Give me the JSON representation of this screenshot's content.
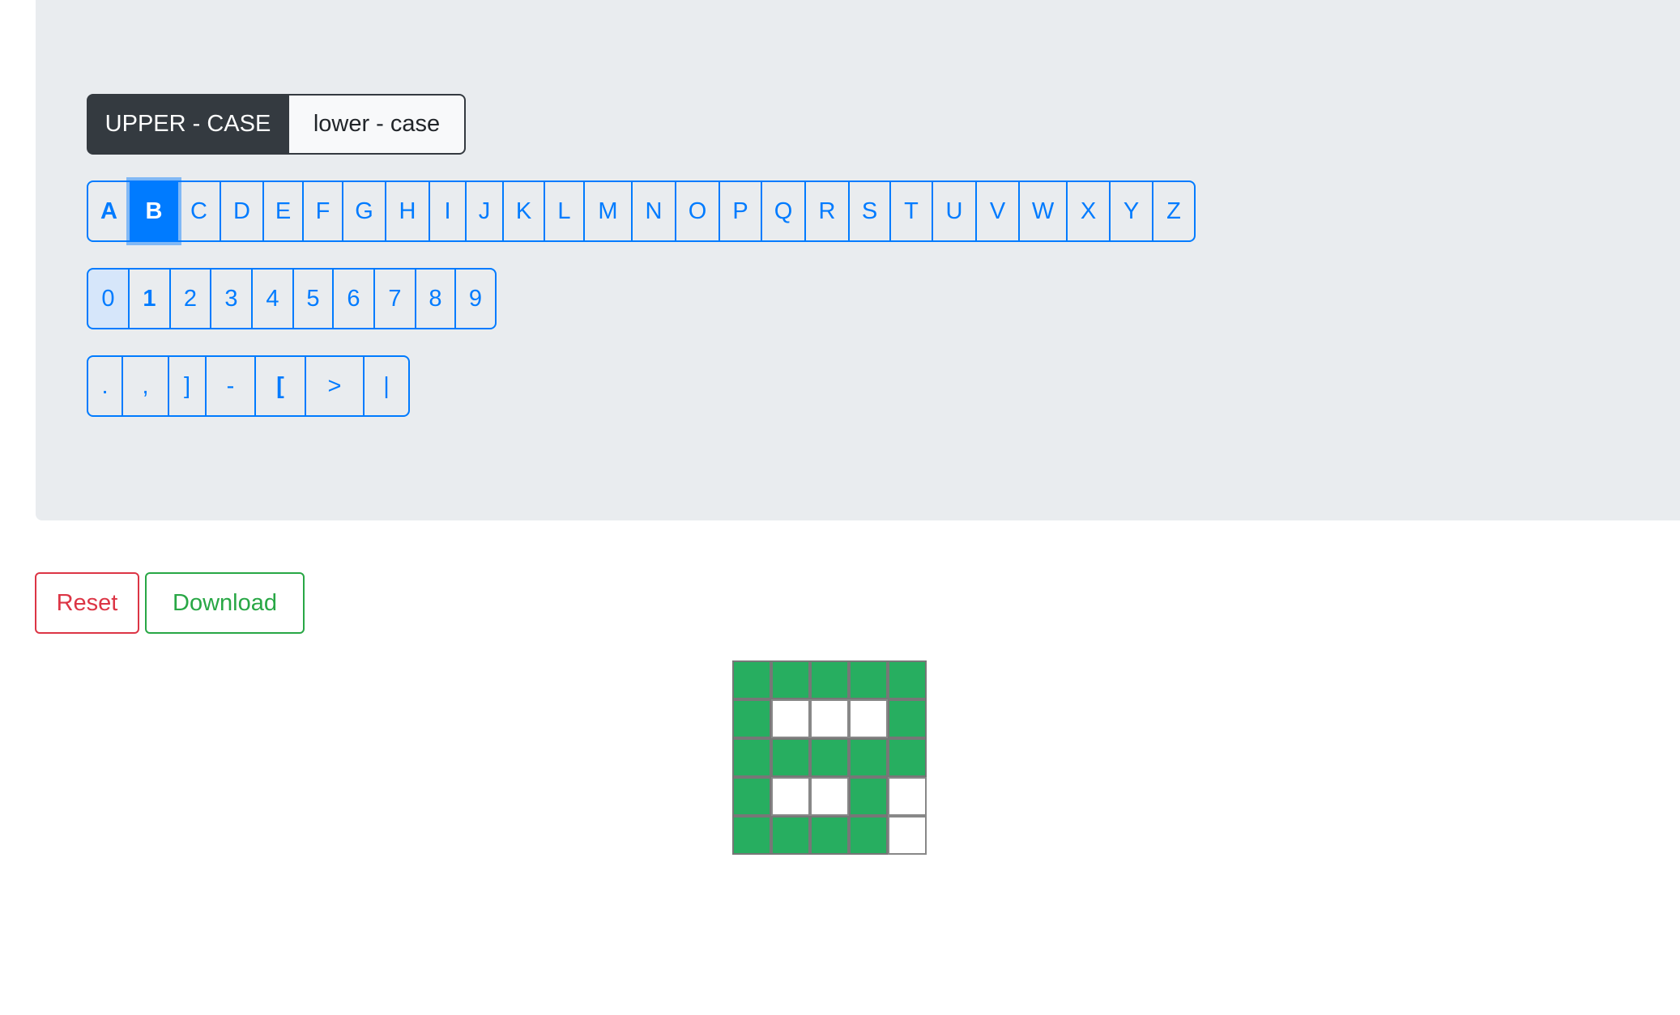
{
  "case_toggle": {
    "upper_label": "UPPER - CASE",
    "lower_label": "lower - case",
    "selected": "upper"
  },
  "letters": [
    "A",
    "B",
    "C",
    "D",
    "E",
    "F",
    "G",
    "H",
    "I",
    "J",
    "K",
    "L",
    "M",
    "N",
    "O",
    "P",
    "Q",
    "R",
    "S",
    "T",
    "U",
    "V",
    "W",
    "X",
    "Y",
    "Z"
  ],
  "letters_selected": "B",
  "letters_bold": [
    "A"
  ],
  "digits": [
    "0",
    "1",
    "2",
    "3",
    "4",
    "5",
    "6",
    "7",
    "8",
    "9"
  ],
  "digits_bold": [
    "1"
  ],
  "digits_highlighted": [
    "0"
  ],
  "symbols": [
    ".",
    ",",
    "]",
    "-",
    "[",
    ">",
    "|"
  ],
  "symbols_bold": [
    "["
  ],
  "actions": {
    "reset_label": "Reset",
    "download_label": "Download"
  },
  "pixel_grid": {
    "rows": 5,
    "cols": 5,
    "cells": [
      [
        1,
        1,
        1,
        1,
        1
      ],
      [
        1,
        0,
        0,
        0,
        1
      ],
      [
        1,
        1,
        1,
        1,
        1
      ],
      [
        1,
        0,
        0,
        1,
        0
      ],
      [
        1,
        1,
        1,
        1,
        0
      ]
    ]
  },
  "colors": {
    "primary": "#007bff",
    "dark": "#343a40",
    "danger": "#dc3545",
    "success": "#28a745",
    "pixel_on": "#27ae60",
    "panel_bg": "#e9ecef"
  }
}
